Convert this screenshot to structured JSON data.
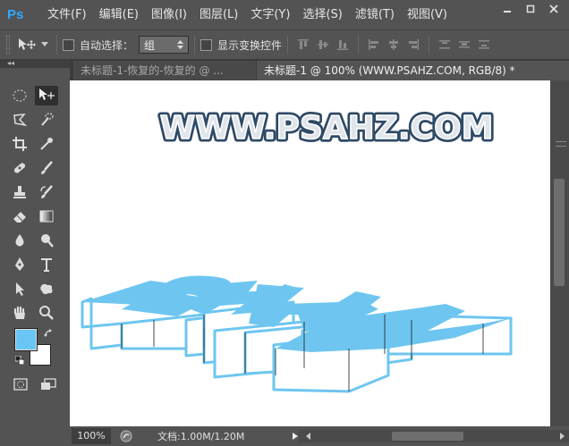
{
  "app": {
    "logo": "Ps",
    "accent_color": "#31a8ff"
  },
  "menubar": {
    "items": [
      "文件(F)",
      "编辑(E)",
      "图像(I)",
      "图层(L)",
      "文字(Y)",
      "选择(S)",
      "滤镜(T)",
      "视图(V)"
    ],
    "window_controls": [
      "minimize-icon",
      "maximize-icon",
      "close-icon"
    ]
  },
  "options": {
    "auto_select_label": "自动选择：",
    "auto_select_value": "组",
    "show_transform_label": "显示变换控件"
  },
  "toolbox": {
    "tools": [
      "marquee-icon",
      "move-icon",
      "lasso-icon",
      "quick-select-icon",
      "crop-icon",
      "eyedropper-icon",
      "healing-icon",
      "brush-icon",
      "stamp-icon",
      "history-brush-icon",
      "eraser-icon",
      "gradient-icon",
      "blur-icon",
      "dodge-icon",
      "pen-icon",
      "type-icon",
      "path-select-icon",
      "shape-icon",
      "hand-icon",
      "zoom-icon"
    ],
    "foreground_color": "#69c6f4",
    "background_color": "#ffffff"
  },
  "tabs": [
    {
      "label": "未标题-1-恢复的-恢复的 @ ...",
      "active": false
    },
    {
      "label": "未标题-1 @ 100% (WWW.PSAHZ.COM, RGB/8) *",
      "active": true
    }
  ],
  "canvas": {
    "logo_text": "WWW.PSAHZ.COM",
    "art_color": "#6ec6f0"
  },
  "status": {
    "zoom": "100%",
    "doc_info": "文档:1.00M/1.20M"
  }
}
